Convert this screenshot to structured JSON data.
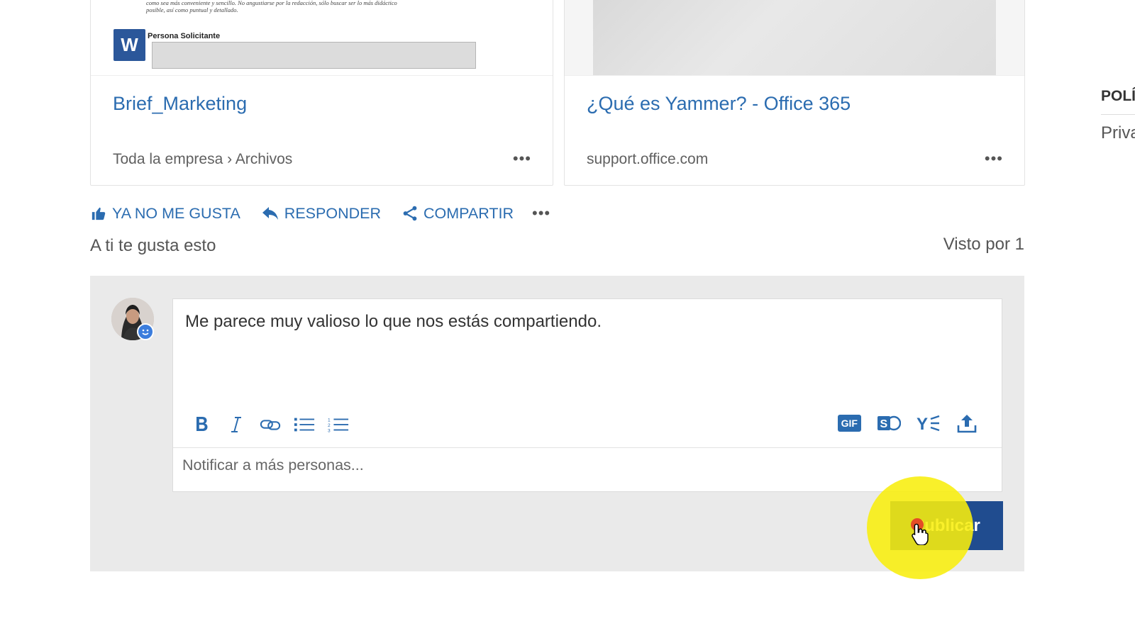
{
  "cards": [
    {
      "preview": {
        "snippet_lines": [
          "como sea más conveniente y sencillo. No angustiarse por la redacción, sólo buscar ser lo más didáctico",
          "posible, así como puntual y detallado."
        ],
        "field_label": "Persona Solicitante",
        "app_icon_letter": "W"
      },
      "title": "Brief_Marketing",
      "source": "Toda la empresa › Archivos",
      "more": "•••"
    },
    {
      "title": "¿Qué es Yammer? - Office 365",
      "source": "support.office.com",
      "more": "•••"
    }
  ],
  "actions": {
    "unlike": "YA NO ME GUSTA",
    "reply": "RESPONDER",
    "share": "COMPARTIR",
    "more": "•••"
  },
  "like_status": "A ti te gusta esto",
  "seen_by": "Visto por 1",
  "composer": {
    "message": "Me parece muy valioso lo que nos estás compartiendo.",
    "notify_placeholder": "Notificar a más personas...",
    "gif_label": "GIF",
    "publish_label": "Publicar"
  },
  "sidebar": {
    "heading": "POLÍ",
    "link": "Priva"
  },
  "colors": {
    "accent": "#2b6cb0",
    "publish_button": "#204c8f",
    "cursor_highlight": "#f8ee0c"
  }
}
